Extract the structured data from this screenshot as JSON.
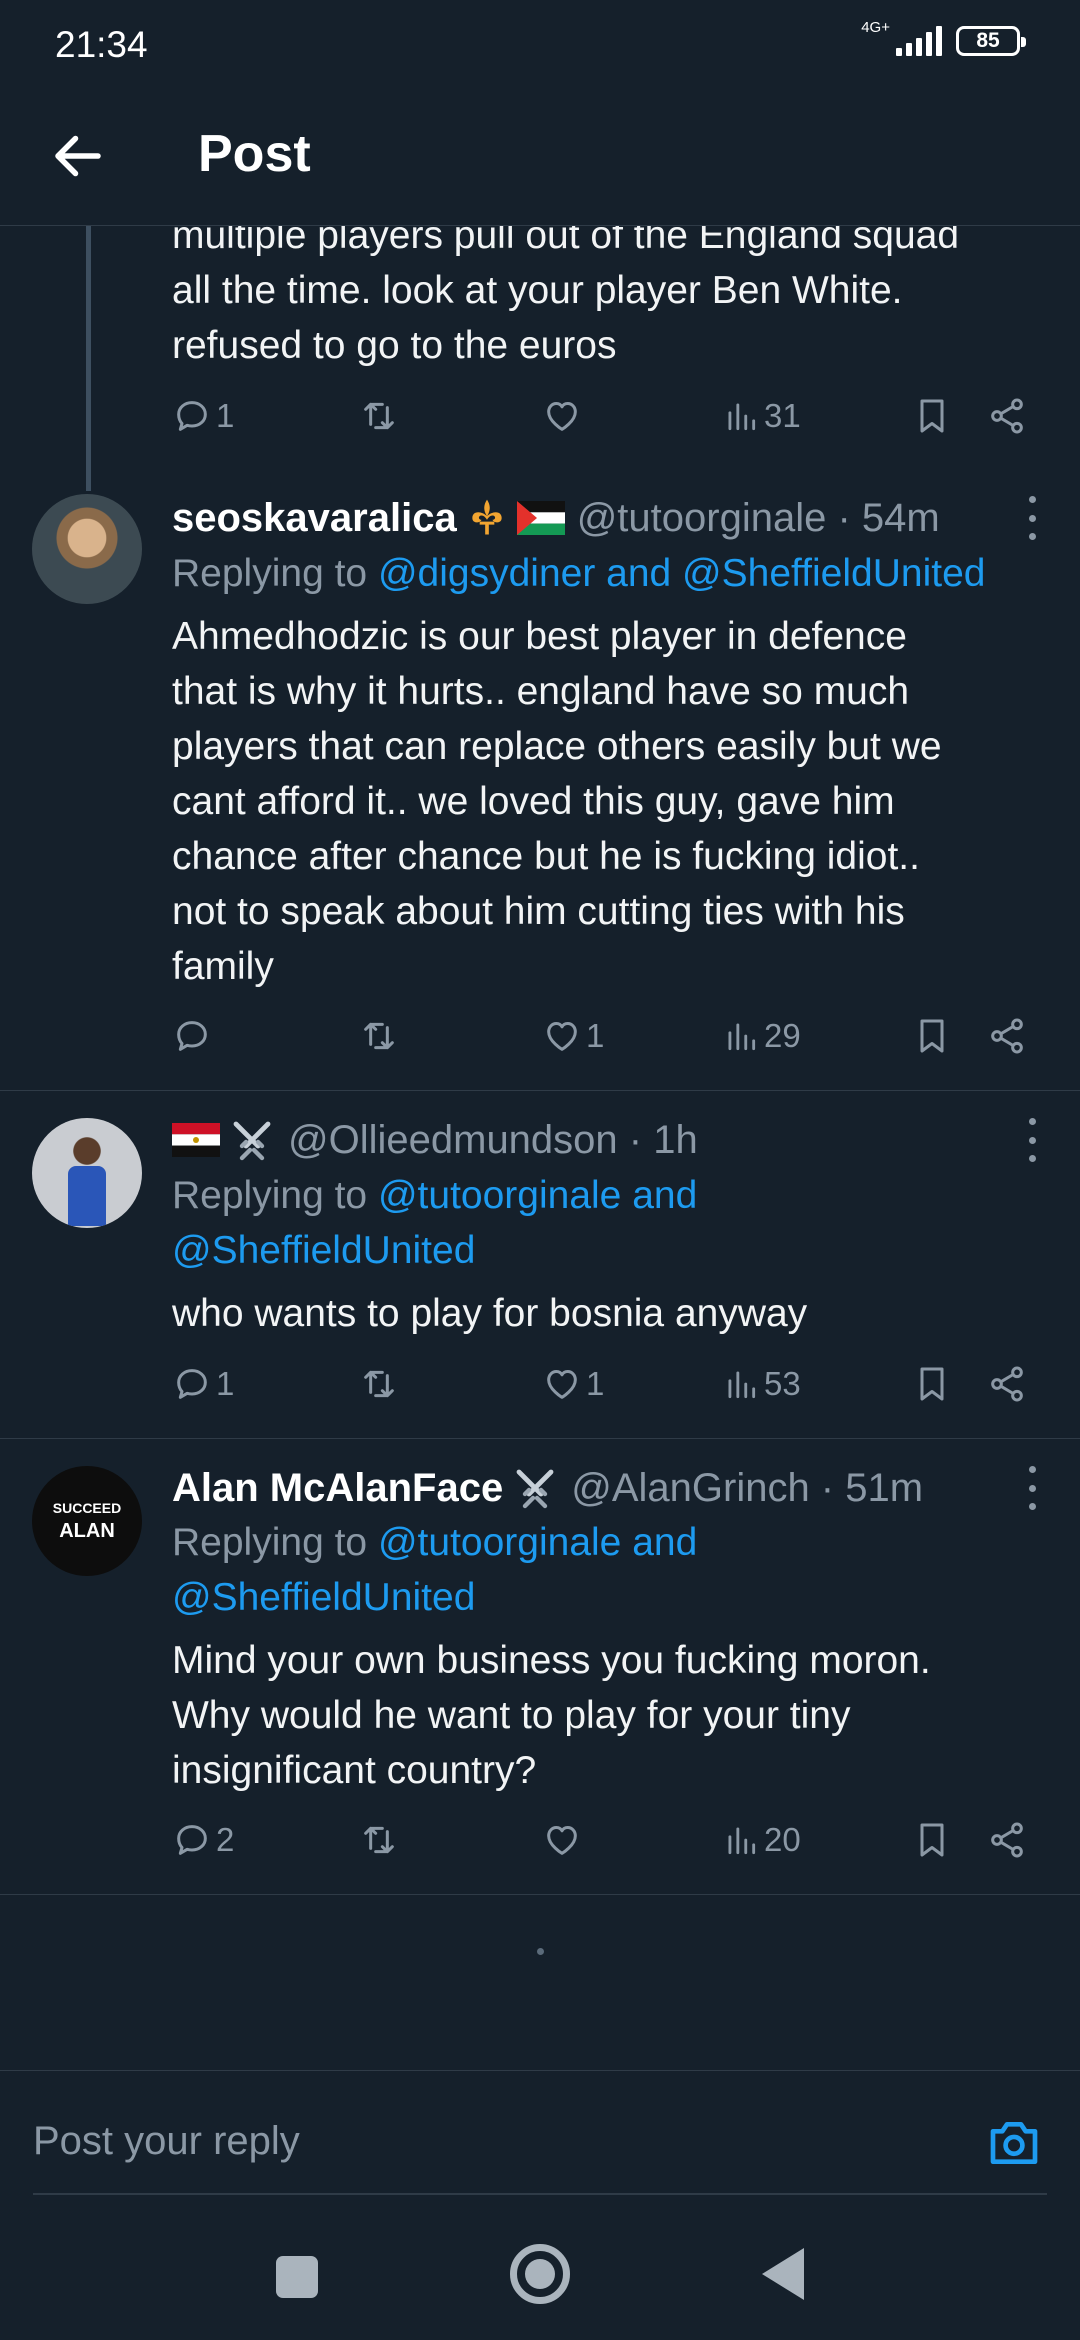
{
  "status_bar": {
    "time": "21:34",
    "network": "4G+",
    "battery": "85"
  },
  "header": {
    "title": "Post"
  },
  "thread_prev": {
    "text_lines": [
      "multiple players pull out of the England squad",
      "all the time. look at your player Ben White.",
      "refused to go to the euros"
    ],
    "replies": "1",
    "reposts": "",
    "likes": "",
    "views": "31"
  },
  "tweets": [
    {
      "display_name": "seoskavaralica",
      "handle": "@tutoorginale · 54m",
      "reply_prefix": "Replying to ",
      "reply_links": "@digsydiner and @SheffieldUnited",
      "text_lines": [
        "Ahmedhodzic is our best player in defence",
        "that is why it hurts.. england have so much",
        "players that can replace others easily but we",
        "cant afford it.. we loved this guy, gave him",
        "chance after chance but he is fucking idiot..",
        "not to speak about him cutting ties with his",
        "family"
      ],
      "replies": "",
      "reposts": "",
      "likes": "1",
      "views": "29"
    },
    {
      "display_name": "",
      "handle": "@Ollieedmundson · 1h",
      "reply_prefix": "Replying to ",
      "reply_links_line1": "@tutoorginale and",
      "reply_links_line2": "@SheffieldUnited",
      "text_lines": [
        "who wants to play for bosnia anyway"
      ],
      "replies": "1",
      "reposts": "",
      "likes": "1",
      "views": "53"
    },
    {
      "display_name": "Alan McAlanFace",
      "handle": "@AlanGrinch · 51m",
      "reply_prefix": "Replying to ",
      "reply_links_line1": "@tutoorginale and",
      "reply_links_line2": "@SheffieldUnited",
      "avatar_text": [
        "SUCCEED",
        "ALAN"
      ],
      "text_lines": [
        "Mind your own business you fucking moron.",
        "Why would he want to play for your tiny",
        "insignificant country?"
      ],
      "replies": "2",
      "reposts": "",
      "likes": "",
      "views": "20"
    }
  ],
  "reply_box": {
    "placeholder": "Post your reply"
  },
  "colors": {
    "background": "#15202b",
    "accent": "#1d9bf0",
    "muted": "#8b98a5",
    "divider": "#2f3b47"
  },
  "icons": [
    "back-arrow-icon",
    "reply-icon",
    "repost-icon",
    "like-icon",
    "views-icon",
    "bookmark-icon",
    "share-icon",
    "more-icon",
    "camera-icon"
  ]
}
